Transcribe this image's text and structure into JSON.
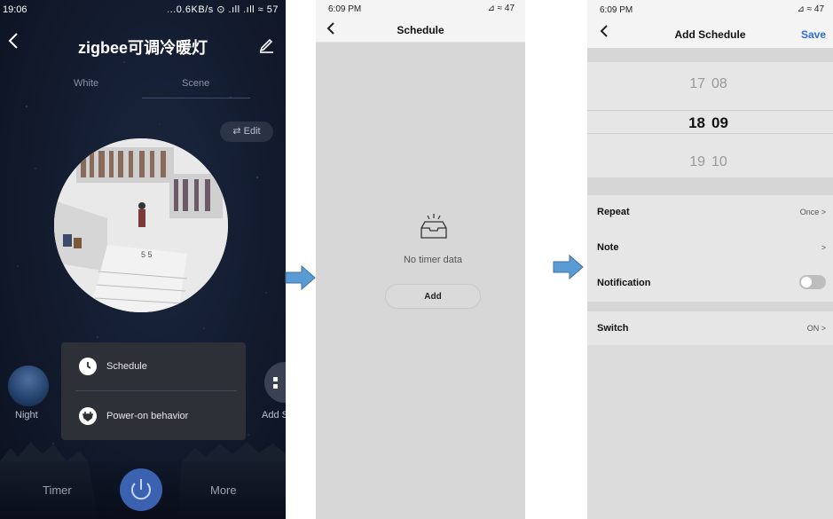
{
  "screen1": {
    "status": {
      "time": "19:06",
      "right": "...0.6KB/s ⊙ .ıll .ıll ≈ 57"
    },
    "title": "zigbee可调冷暖灯",
    "tabs": [
      "White",
      "Scene"
    ],
    "edit_pill": "Edit",
    "scenes": {
      "night_label": "Night",
      "add_label": "Add S"
    },
    "popup": {
      "schedule": "Schedule",
      "power_on": "Power-on behavior"
    },
    "bottom": {
      "timer": "Timer",
      "more": "More"
    },
    "icons": {
      "back": "chevron-left-icon",
      "edit": "pencil-icon",
      "edit_pill": "sliders-icon",
      "schedule": "clock-icon",
      "power_on": "plug-icon",
      "power": "power-icon"
    },
    "colors": {
      "accent": "#3a62b0",
      "popup_bg": "#2e3038"
    }
  },
  "screen2": {
    "status": {
      "time": "6:09 PM",
      "right": "⊿ ≈ 47"
    },
    "title": "Schedule",
    "empty_text": "No timer data",
    "add_label": "Add",
    "icons": {
      "back": "chevron-left-icon",
      "empty": "empty-tray-icon"
    }
  },
  "screen3": {
    "status": {
      "time": "6:09 PM",
      "right": "⊿ ≈ 47"
    },
    "title": "Add Schedule",
    "save_label": "Save",
    "picker": {
      "top": {
        "hour": "17",
        "minute": "08"
      },
      "selected": {
        "hour": "18",
        "minute": "09"
      },
      "bottom": {
        "hour": "19",
        "minute": "10"
      }
    },
    "rows": {
      "repeat": {
        "label": "Repeat",
        "value": "Once"
      },
      "note": {
        "label": "Note",
        "value": ""
      },
      "notification": {
        "label": "Notification",
        "enabled": false
      }
    },
    "switch_row": {
      "label": "Switch",
      "value": "ON"
    },
    "chevron": ">",
    "colors": {
      "save": "#2d6cdf"
    }
  }
}
